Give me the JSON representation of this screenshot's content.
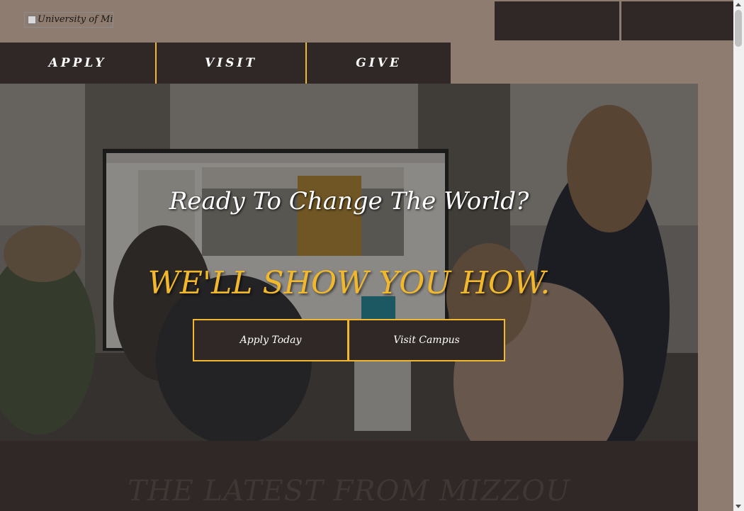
{
  "header": {
    "logo_alt": "University of Missouri"
  },
  "nav": {
    "apply": "APPLY",
    "visit": "VISIT",
    "give": "GIVE"
  },
  "hero": {
    "title": "Ready To Change The World?",
    "subtitle": "WE'LL SHOW YOU HOW.",
    "apply_button": "Apply Today",
    "visit_button": "Visit Campus"
  },
  "latest": {
    "title": "THE LATEST FROM MIZZOU"
  },
  "colors": {
    "accent_gold": "#f1b82d",
    "dark_brown": "#302826",
    "taupe": "#8f7c70"
  }
}
